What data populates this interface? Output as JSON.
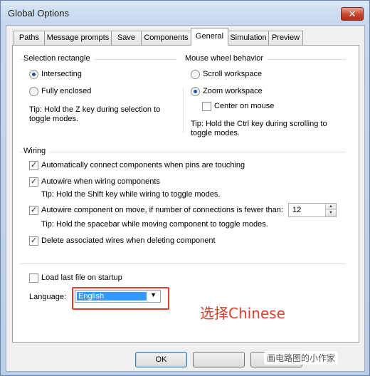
{
  "window": {
    "title": "Global Options",
    "close_glyph": "✕"
  },
  "tabs": [
    {
      "label": "Paths"
    },
    {
      "label": "Message prompts"
    },
    {
      "label": "Save"
    },
    {
      "label": "Components"
    },
    {
      "label": "General",
      "active": true
    },
    {
      "label": "Simulation"
    },
    {
      "label": "Preview"
    }
  ],
  "selection_rectangle": {
    "title": "Selection rectangle",
    "options": [
      {
        "label": "Intersecting",
        "selected": true
      },
      {
        "label": "Fully enclosed",
        "selected": false
      }
    ],
    "tip_line1": "Tip: Hold the Z key during selection to",
    "tip_line2": "toggle modes."
  },
  "mouse_wheel": {
    "title": "Mouse wheel behavior",
    "options": [
      {
        "label": "Scroll workspace",
        "selected": false
      },
      {
        "label": "Zoom workspace",
        "selected": true
      }
    ],
    "center_on_mouse": {
      "label": "Center on mouse",
      "checked": false
    },
    "tip_line1": "Tip: Hold the Ctrl key during scrolling to",
    "tip_line2": "toggle modes."
  },
  "wiring": {
    "title": "Wiring",
    "auto_connect": {
      "label": "Automatically connect components when pins are touching",
      "checked": true
    },
    "autowire": {
      "label": "Autowire when wiring components",
      "checked": true
    },
    "autowire_tip": "Tip: Hold the Shift key while wiring to toggle modes.",
    "autowire_move": {
      "label": "Autowire component on move, if number of connections is fewer than:",
      "checked": true
    },
    "autowire_move_value": "12",
    "autowire_move_tip": "Tip: Hold the spacebar while moving component to toggle modes.",
    "delete_wires": {
      "label": "Delete associated wires when deleting component",
      "checked": true
    }
  },
  "load_last_file": {
    "label": "Load last file on startup",
    "checked": false
  },
  "language": {
    "label": "Language:",
    "value": "English"
  },
  "annotation": "选择Chinese",
  "buttons": {
    "ok": "OK"
  },
  "watermark": "画电路图的小作家",
  "icons": {
    "check": "✓",
    "dropdown_arrow": "▼",
    "spin_up": "▲",
    "spin_down": "▼"
  }
}
